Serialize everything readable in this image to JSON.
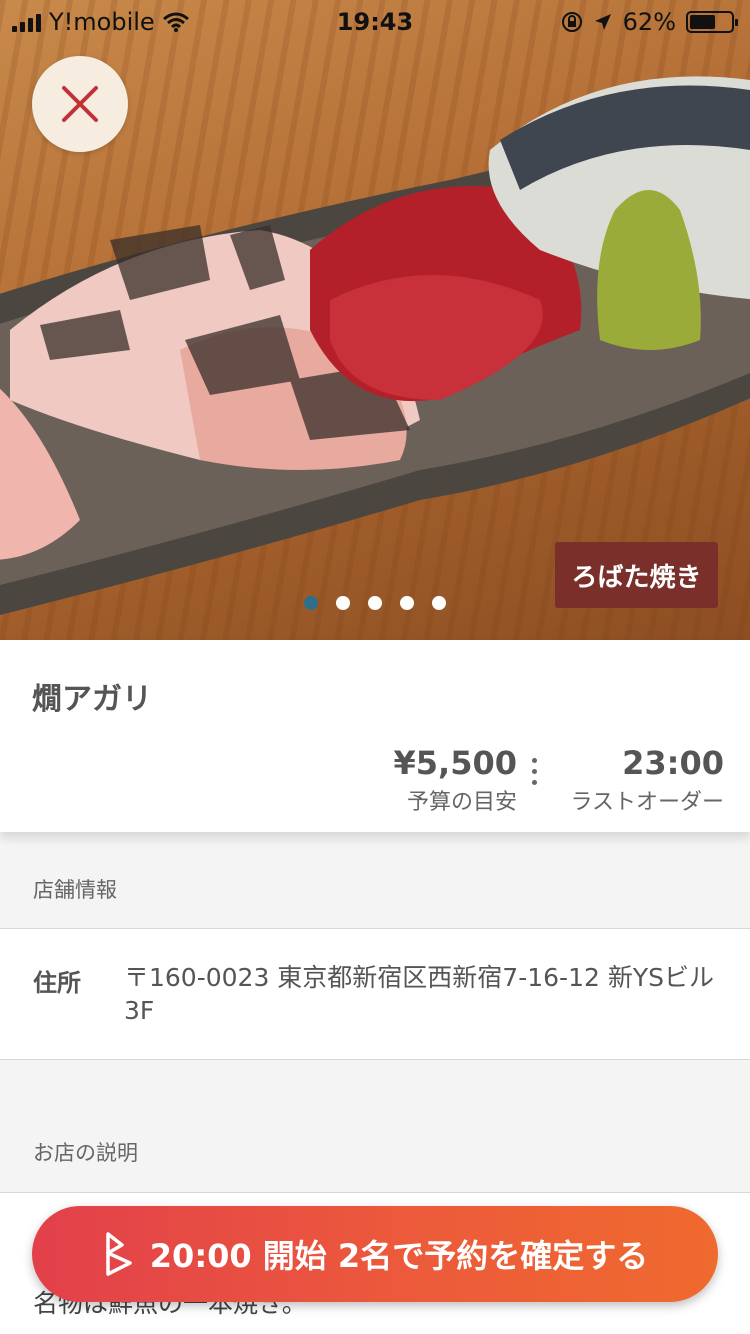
{
  "status_bar": {
    "carrier": "Y!mobile",
    "time": "19:43",
    "battery_percent": "62%",
    "battery_level": 0.62,
    "icons": [
      "signal-icon",
      "wifi-icon",
      "rotation-lock-icon",
      "location-arrow-icon",
      "battery-icon"
    ]
  },
  "hero": {
    "category_badge": "ろばた焼き",
    "photo_count": 5,
    "active_photo_index": 0,
    "close_icon": "close-icon"
  },
  "shop": {
    "name": "燗アガリ",
    "budget_value": "¥5,500",
    "budget_label": "予算の目安",
    "last_order_value": "23:00",
    "last_order_label": "ラストオーダー"
  },
  "store_info": {
    "section_title": "店舗情報",
    "address_label": "住所",
    "address_value": "〒160-0023 東京都新宿区西新宿7-16-12 新YSビル3F"
  },
  "description": {
    "section_title": "お店の説明",
    "visible_text": "名物は鮮魚の一本焼き。"
  },
  "reserve_button": {
    "label": "20:00 開始 2名で予約を確定する",
    "icon": "brand-logo-icon"
  },
  "colors": {
    "badge_bg": "#7a2f2a",
    "dot_active": "#2f6f8a",
    "button_gradient_start": "#e2404b",
    "button_gradient_end": "#ef6a2e",
    "close_icon": "#c0313a"
  }
}
